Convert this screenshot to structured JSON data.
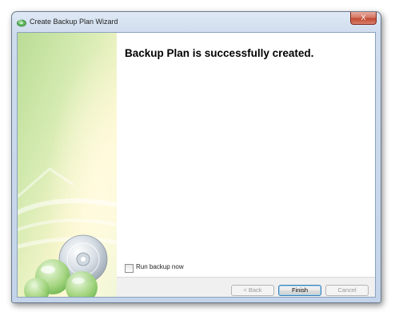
{
  "window": {
    "title": "Create Backup Plan Wizard",
    "close_label": "X"
  },
  "main": {
    "heading": "Backup Plan is successfully created."
  },
  "options": {
    "run_backup_now": {
      "label": "Run backup now",
      "checked": false
    }
  },
  "buttons": {
    "back": "< Back",
    "finish": "Finish",
    "cancel": "Cancel"
  },
  "colors": {
    "side_panel_green": "#a8d47a",
    "side_panel_yellow": "#fff7c4",
    "title_bar": "#cfdcee",
    "close_button": "#c24a33"
  },
  "icons": {
    "app": "cloud-backup-icon",
    "side_panel": "cd-disc-graphic"
  }
}
